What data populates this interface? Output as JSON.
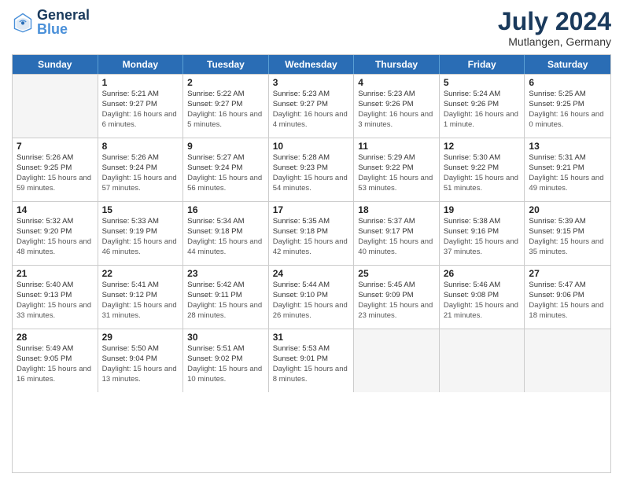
{
  "header": {
    "logo_general": "General",
    "logo_blue": "Blue",
    "month_year": "July 2024",
    "location": "Mutlangen, Germany"
  },
  "weekdays": [
    "Sunday",
    "Monday",
    "Tuesday",
    "Wednesday",
    "Thursday",
    "Friday",
    "Saturday"
  ],
  "rows": [
    [
      {
        "day": "",
        "empty": true
      },
      {
        "day": "1",
        "sunrise": "5:21 AM",
        "sunset": "9:27 PM",
        "daylight": "16 hours and 6 minutes."
      },
      {
        "day": "2",
        "sunrise": "5:22 AM",
        "sunset": "9:27 PM",
        "daylight": "16 hours and 5 minutes."
      },
      {
        "day": "3",
        "sunrise": "5:23 AM",
        "sunset": "9:27 PM",
        "daylight": "16 hours and 4 minutes."
      },
      {
        "day": "4",
        "sunrise": "5:23 AM",
        "sunset": "9:26 PM",
        "daylight": "16 hours and 3 minutes."
      },
      {
        "day": "5",
        "sunrise": "5:24 AM",
        "sunset": "9:26 PM",
        "daylight": "16 hours and 1 minute."
      },
      {
        "day": "6",
        "sunrise": "5:25 AM",
        "sunset": "9:25 PM",
        "daylight": "16 hours and 0 minutes."
      }
    ],
    [
      {
        "day": "7",
        "sunrise": "5:26 AM",
        "sunset": "9:25 PM",
        "daylight": "15 hours and 59 minutes."
      },
      {
        "day": "8",
        "sunrise": "5:26 AM",
        "sunset": "9:24 PM",
        "daylight": "15 hours and 57 minutes."
      },
      {
        "day": "9",
        "sunrise": "5:27 AM",
        "sunset": "9:24 PM",
        "daylight": "15 hours and 56 minutes."
      },
      {
        "day": "10",
        "sunrise": "5:28 AM",
        "sunset": "9:23 PM",
        "daylight": "15 hours and 54 minutes."
      },
      {
        "day": "11",
        "sunrise": "5:29 AM",
        "sunset": "9:22 PM",
        "daylight": "15 hours and 53 minutes."
      },
      {
        "day": "12",
        "sunrise": "5:30 AM",
        "sunset": "9:22 PM",
        "daylight": "15 hours and 51 minutes."
      },
      {
        "day": "13",
        "sunrise": "5:31 AM",
        "sunset": "9:21 PM",
        "daylight": "15 hours and 49 minutes."
      }
    ],
    [
      {
        "day": "14",
        "sunrise": "5:32 AM",
        "sunset": "9:20 PM",
        "daylight": "15 hours and 48 minutes."
      },
      {
        "day": "15",
        "sunrise": "5:33 AM",
        "sunset": "9:19 PM",
        "daylight": "15 hours and 46 minutes."
      },
      {
        "day": "16",
        "sunrise": "5:34 AM",
        "sunset": "9:18 PM",
        "daylight": "15 hours and 44 minutes."
      },
      {
        "day": "17",
        "sunrise": "5:35 AM",
        "sunset": "9:18 PM",
        "daylight": "15 hours and 42 minutes."
      },
      {
        "day": "18",
        "sunrise": "5:37 AM",
        "sunset": "9:17 PM",
        "daylight": "15 hours and 40 minutes."
      },
      {
        "day": "19",
        "sunrise": "5:38 AM",
        "sunset": "9:16 PM",
        "daylight": "15 hours and 37 minutes."
      },
      {
        "day": "20",
        "sunrise": "5:39 AM",
        "sunset": "9:15 PM",
        "daylight": "15 hours and 35 minutes."
      }
    ],
    [
      {
        "day": "21",
        "sunrise": "5:40 AM",
        "sunset": "9:13 PM",
        "daylight": "15 hours and 33 minutes."
      },
      {
        "day": "22",
        "sunrise": "5:41 AM",
        "sunset": "9:12 PM",
        "daylight": "15 hours and 31 minutes."
      },
      {
        "day": "23",
        "sunrise": "5:42 AM",
        "sunset": "9:11 PM",
        "daylight": "15 hours and 28 minutes."
      },
      {
        "day": "24",
        "sunrise": "5:44 AM",
        "sunset": "9:10 PM",
        "daylight": "15 hours and 26 minutes."
      },
      {
        "day": "25",
        "sunrise": "5:45 AM",
        "sunset": "9:09 PM",
        "daylight": "15 hours and 23 minutes."
      },
      {
        "day": "26",
        "sunrise": "5:46 AM",
        "sunset": "9:08 PM",
        "daylight": "15 hours and 21 minutes."
      },
      {
        "day": "27",
        "sunrise": "5:47 AM",
        "sunset": "9:06 PM",
        "daylight": "15 hours and 18 minutes."
      }
    ],
    [
      {
        "day": "28",
        "sunrise": "5:49 AM",
        "sunset": "9:05 PM",
        "daylight": "15 hours and 16 minutes."
      },
      {
        "day": "29",
        "sunrise": "5:50 AM",
        "sunset": "9:04 PM",
        "daylight": "15 hours and 13 minutes."
      },
      {
        "day": "30",
        "sunrise": "5:51 AM",
        "sunset": "9:02 PM",
        "daylight": "15 hours and 10 minutes."
      },
      {
        "day": "31",
        "sunrise": "5:53 AM",
        "sunset": "9:01 PM",
        "daylight": "15 hours and 8 minutes."
      },
      {
        "day": "",
        "empty": true
      },
      {
        "day": "",
        "empty": true
      },
      {
        "day": "",
        "empty": true
      }
    ]
  ]
}
